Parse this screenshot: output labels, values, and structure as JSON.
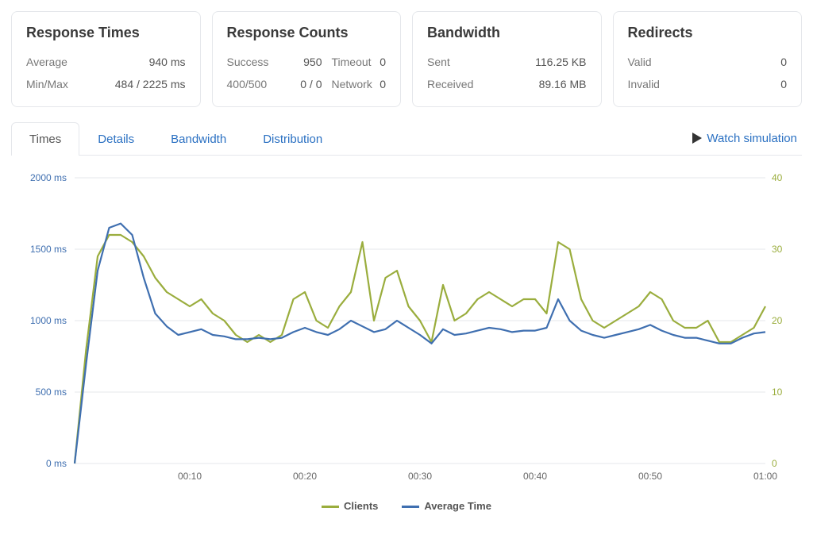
{
  "cards": {
    "response_times": {
      "title": "Response Times",
      "rows": [
        {
          "label": "Average",
          "val": "940 ms"
        },
        {
          "label": "Min/Max",
          "val": "484 / 2225 ms"
        }
      ]
    },
    "response_counts": {
      "title": "Response Counts",
      "rows": [
        {
          "label": "Success",
          "val": "950",
          "label2": "Timeout",
          "val2": "0"
        },
        {
          "label": "400/500",
          "val": "0 / 0",
          "label2": "Network",
          "val2": "0"
        }
      ]
    },
    "bandwidth": {
      "title": "Bandwidth",
      "rows": [
        {
          "label": "Sent",
          "val": "116.25 KB"
        },
        {
          "label": "Received",
          "val": "89.16 MB"
        }
      ]
    },
    "redirects": {
      "title": "Redirects",
      "rows": [
        {
          "label": "Valid",
          "val": "0"
        },
        {
          "label": "Invalid",
          "val": "0"
        }
      ]
    }
  },
  "tabs": {
    "items": [
      "Times",
      "Details",
      "Bandwidth",
      "Distribution"
    ],
    "active": 0,
    "watch": "Watch simulation"
  },
  "legend": {
    "clients": "Clients",
    "avgtime": "Average Time"
  },
  "chart_data": {
    "type": "line",
    "xlabel": "",
    "x_ticks": [
      "00:10",
      "00:20",
      "00:30",
      "00:40",
      "00:50",
      "01:00"
    ],
    "y_left": {
      "label": "",
      "ticks": [
        "0 ms",
        "500 ms",
        "1000 ms",
        "1500 ms",
        "2000 ms"
      ],
      "min": 0,
      "max": 2000
    },
    "y_right": {
      "label": "",
      "ticks": [
        "0",
        "10",
        "20",
        "30",
        "40"
      ],
      "min": 0,
      "max": 40
    },
    "x_seconds": [
      0,
      1,
      2,
      3,
      4,
      5,
      6,
      7,
      8,
      9,
      10,
      11,
      12,
      13,
      14,
      15,
      16,
      17,
      18,
      19,
      20,
      21,
      22,
      23,
      24,
      25,
      26,
      27,
      28,
      29,
      30,
      31,
      32,
      33,
      34,
      35,
      36,
      37,
      38,
      39,
      40,
      41,
      42,
      43,
      44,
      45,
      46,
      47,
      48,
      49,
      50,
      51,
      52,
      53,
      54,
      55,
      56,
      57,
      58,
      59,
      60
    ],
    "series": [
      {
        "name": "Clients",
        "axis": "right",
        "color": "#9aad3d",
        "values": [
          0,
          16,
          29,
          32,
          32,
          31,
          29,
          26,
          24,
          23,
          22,
          23,
          21,
          20,
          18,
          17,
          18,
          17,
          18,
          23,
          24,
          20,
          19,
          22,
          24,
          31,
          20,
          26,
          27,
          22,
          20,
          17,
          25,
          20,
          21,
          23,
          24,
          23,
          22,
          23,
          23,
          21,
          31,
          30,
          23,
          20,
          19,
          20,
          21,
          22,
          24,
          23,
          20,
          19,
          19,
          20,
          17,
          17,
          18,
          19,
          22
        ]
      },
      {
        "name": "Average Time",
        "axis": "left",
        "color": "#3f6fb0",
        "values": [
          0,
          700,
          1350,
          1650,
          1680,
          1600,
          1300,
          1050,
          960,
          900,
          920,
          940,
          900,
          890,
          870,
          870,
          880,
          870,
          880,
          920,
          950,
          920,
          900,
          940,
          1000,
          960,
          920,
          940,
          1000,
          950,
          900,
          840,
          940,
          900,
          910,
          930,
          950,
          940,
          920,
          930,
          930,
          950,
          1150,
          1000,
          930,
          900,
          880,
          900,
          920,
          940,
          970,
          930,
          900,
          880,
          880,
          860,
          840,
          840,
          880,
          910,
          920
        ]
      }
    ]
  }
}
